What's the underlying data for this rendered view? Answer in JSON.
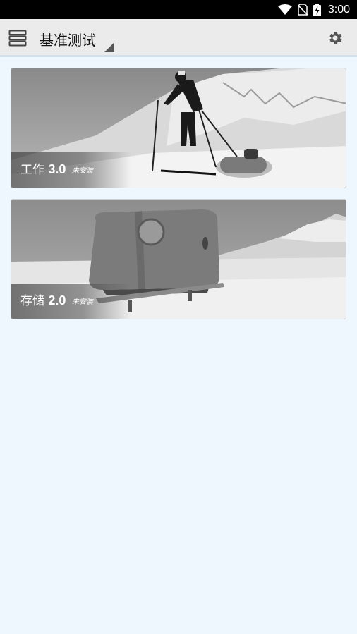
{
  "status_bar": {
    "time": "3:00",
    "icons": [
      "wifi-icon",
      "no-sim-icon",
      "battery-charging-icon"
    ]
  },
  "app_bar": {
    "title": "基准测试",
    "menu_icon": "menu-stack-icon",
    "settings_icon": "gear-icon"
  },
  "benchmarks": [
    {
      "name": "工作",
      "version": "3.0",
      "status": "未安装",
      "image": "skier-pulling-sled"
    },
    {
      "name": "存储",
      "version": "2.0",
      "status": "未安装",
      "image": "cabin-on-sled"
    }
  ],
  "colors": {
    "background": "#eef6fe",
    "app_bar": "#ebebeb",
    "status_bar": "#000000"
  }
}
